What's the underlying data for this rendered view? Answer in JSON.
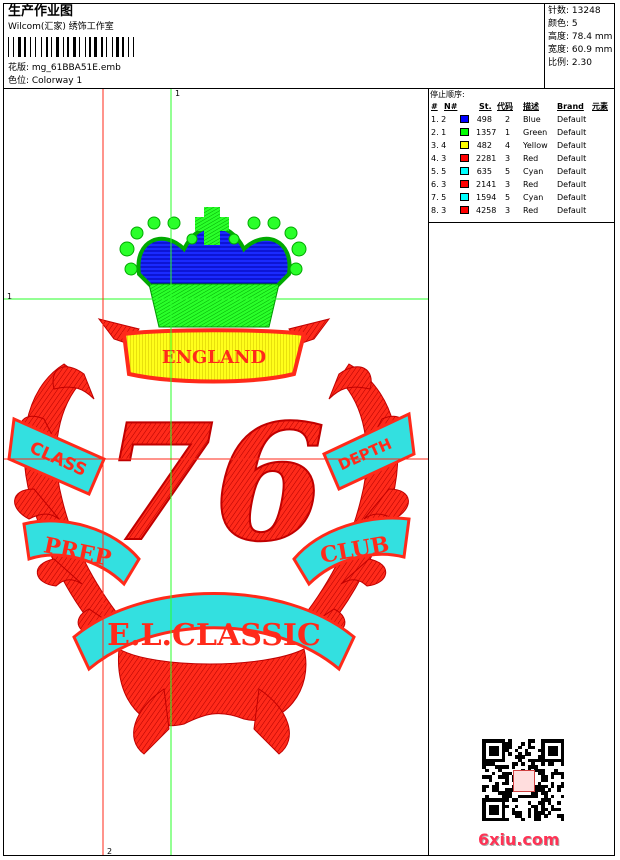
{
  "header": {
    "title": "生产作业图",
    "company": "Wilcom(汇家) 绣饰工作室",
    "design_label": "花版: mg_61BBA51E.emb",
    "colorway_label": "色位: Colorway 1"
  },
  "stats": [
    {
      "label": "针数:",
      "value": "13248"
    },
    {
      "label": "颜色:",
      "value": "5"
    },
    {
      "label": "高度:",
      "value": "78.4 mm"
    },
    {
      "label": "宽度:",
      "value": "60.9 mm"
    },
    {
      "label": "比例:",
      "value": "2.30"
    }
  ],
  "stop_table": {
    "caption": "停止顺序:",
    "headers": [
      "#",
      "N#",
      "St.",
      "代码",
      "描述",
      "Brand",
      "元素"
    ],
    "rows": [
      {
        "idx": "1. 2",
        "color": "#0000ff",
        "st": "498",
        "code": "2",
        "desc": "Blue",
        "brand": "Default"
      },
      {
        "idx": "2. 1",
        "color": "#00ff00",
        "st": "1357",
        "code": "1",
        "desc": "Green",
        "brand": "Default"
      },
      {
        "idx": "3. 4",
        "color": "#ffff00",
        "st": "482",
        "code": "4",
        "desc": "Yellow",
        "brand": "Default"
      },
      {
        "idx": "4. 3",
        "color": "#ff0000",
        "st": "2281",
        "code": "3",
        "desc": "Red",
        "brand": "Default"
      },
      {
        "idx": "5. 5",
        "color": "#00ffff",
        "st": "635",
        "code": "5",
        "desc": "Cyan",
        "brand": "Default"
      },
      {
        "idx": "6. 3",
        "color": "#ff0000",
        "st": "2141",
        "code": "3",
        "desc": "Red",
        "brand": "Default"
      },
      {
        "idx": "7. 5",
        "color": "#00ffff",
        "st": "1594",
        "code": "5",
        "desc": "Cyan",
        "brand": "Default"
      },
      {
        "idx": "8. 3",
        "color": "#ff0000",
        "st": "4258",
        "code": "3",
        "desc": "Red",
        "brand": "Default"
      }
    ]
  },
  "design": {
    "number": "76",
    "banner_top": "ENGLAND",
    "banner_left": "CLASS",
    "banner_right": "DEPTH",
    "ribbon_left": "PREP",
    "ribbon_right": "CLUB",
    "ribbon_bottom": "E.L.CLASSIC",
    "colors": {
      "red": "#ff2a1a",
      "cyan": "#33e0e0",
      "green": "#2aff2a",
      "blue": "#1a2aff",
      "yellow": "#ffff1a"
    }
  },
  "guides": {
    "green_v": "1",
    "green_h": "1",
    "red_v": "2"
  },
  "watermark": "6xiu.com"
}
